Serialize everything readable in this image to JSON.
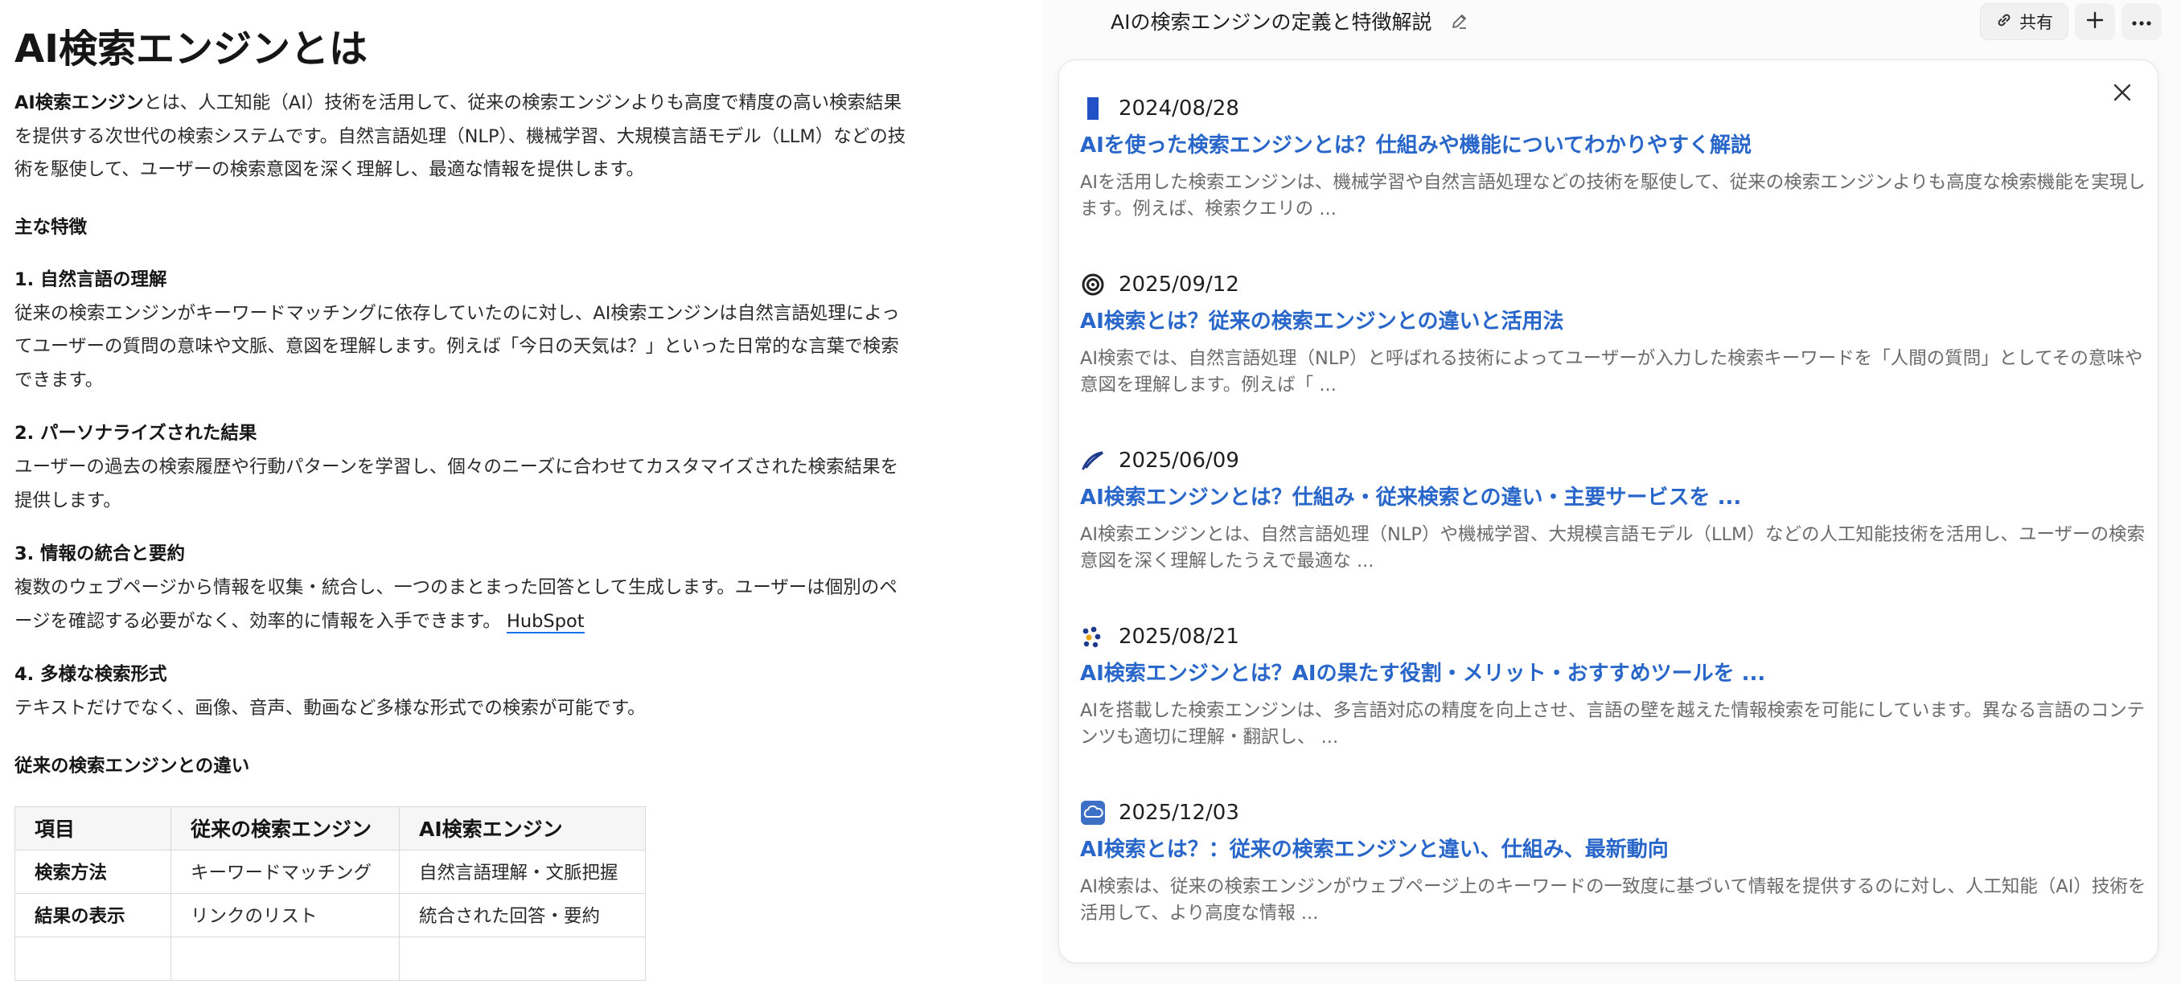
{
  "article": {
    "title": "AI検索エンジンとは",
    "intro_bold": "AI検索エンジン",
    "intro_rest": "とは、人工知能（AI）技術を活用して、従来の検索エンジンよりも高度で精度の高い検索結果を提供する次世代の検索システムです。自然言語処理（NLP）、機械学習、大規模言語モデル（LLM）などの技術を駆使して、ユーザーの検索意図を深く理解し、最適な情報を提供します。",
    "features_heading": "主な特徴",
    "f1_heading": "1. 自然言語の理解",
    "f1_text": "従来の検索エンジンがキーワードマッチングに依存していたのに対し、AI検索エンジンは自然言語処理によってユーザーの質問の意味や文脈、意図を理解します。例えば「今日の天気は？」といった日常的な言葉で検索できます。",
    "f2_heading": "2. パーソナライズされた結果",
    "f2_text": "ユーザーの過去の検索履歴や行動パターンを学習し、個々のニーズに合わせてカスタマイズされた検索結果を提供します。",
    "f3_heading": "3. 情報の統合と要約",
    "f3_text": "複数のウェブページから情報を収集・統合し、一つのまとまった回答として生成します。ユーザーは個別のページを確認する必要がなく、効率的に情報を入手できます。",
    "f3_link": "HubSpot",
    "f4_heading": "4. 多様な検索形式",
    "f4_text": "テキストだけでなく、画像、音声、動画など多様な形式での検索が可能です。",
    "diff_heading": "従来の検索エンジンとの違い",
    "table": {
      "headers": [
        "項目",
        "従来の検索エンジン",
        "AI検索エンジン"
      ],
      "rows": [
        [
          "検索方法",
          "キーワードマッチング",
          "自然言語理解・文脈把握"
        ],
        [
          "結果の表示",
          "リンクのリスト",
          "統合された回答・要約"
        ]
      ]
    }
  },
  "panel": {
    "doc_title": "AIの検索エンジンの定義と特徴解説",
    "share_label": "共有",
    "results": [
      {
        "icon": "bar-favicon-icon",
        "date": "2024/08/28",
        "title": "AIを使った検索エンジンとは？仕組みや機能についてわかりやすく解説",
        "snippet": "AIを活用した検索エンジンは、機械学習や自然言語処理などの技術を駆使して、従来の検索エンジンよりも高度な検索機能を実現します。例えば、検索クエリの ..."
      },
      {
        "icon": "ring-favicon-icon",
        "date": "2025/09/12",
        "title": "AI検索とは？従来の検索エンジンとの違いと活用法",
        "snippet": "AI検索では、自然言語処理（NLP）と呼ばれる技術によってユーザーが入力した検索キーワードを「人間の質問」としてその意味や意図を理解します。例えば「 ..."
      },
      {
        "icon": "leaf-favicon-icon",
        "date": "2025/06/09",
        "title": "AI検索エンジンとは？仕組み・従来検索との違い・主要サービスを ...",
        "snippet": "AI検索エンジンとは、自然言語処理（NLP）や機械学習、大規模言語モデル（LLM）などの人工知能技術を活用し、ユーザーの検索意図を深く理解したうえで最適な ..."
      },
      {
        "icon": "dots-favicon-icon",
        "date": "2025/08/21",
        "title": "AI検索エンジンとは？AIの果たす役割・メリット・おすすめツールを ...",
        "snippet": "AIを搭載した検索エンジンは、多言語対応の精度を向上させ、言語の壁を越えた情報検索を可能にしています。異なる言語のコンテンツも適切に理解・翻訳し、 ..."
      },
      {
        "icon": "cloud-favicon-icon",
        "date": "2025/12/03",
        "title": "AI検索とは？：従来の検索エンジンと違い、仕組み、最新動向",
        "snippet": "AI検索は、従来の検索エンジンがウェブページ上のキーワードの一致度に基づいて情報を提供するのに対し、人工知能（AI）技術を活用して、より高度な情報 ..."
      }
    ]
  }
}
